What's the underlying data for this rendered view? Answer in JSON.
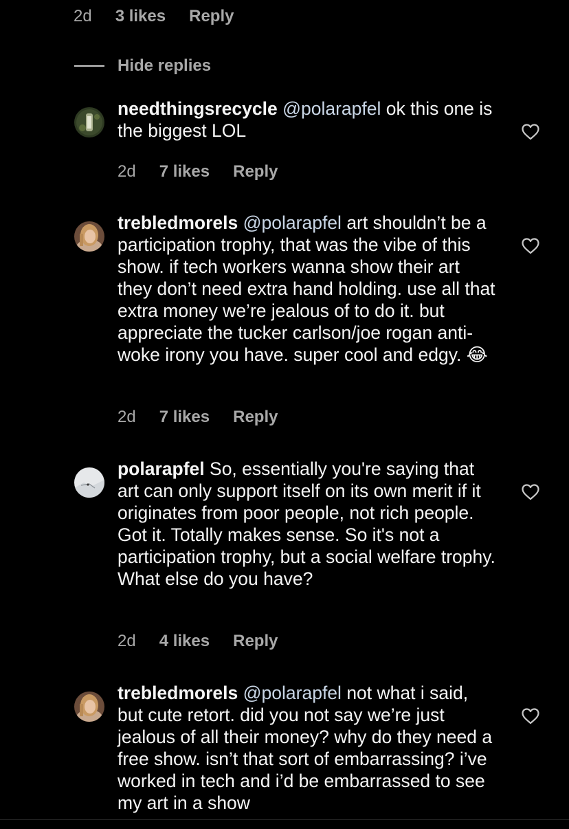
{
  "top_meta": {
    "time": "2d",
    "likes": "3 likes",
    "reply": "Reply"
  },
  "hide_replies": {
    "label": "Hide replies"
  },
  "comments": [
    {
      "username": "needthingsrecycle",
      "mention": "@polarapfel",
      "text": "ok this one is the biggest LOL",
      "time": "2d",
      "likes": "7 likes",
      "reply": "Reply",
      "avatar": "green-photo"
    },
    {
      "username": "trebledmorels",
      "mention": "@polarapfel",
      "text": "art shouldn’t be a participation trophy, that was the vibe of this show. if tech workers wanna show their art they don’t need extra hand holding. use all that extra money we’re jealous of to do it. but appreciate the tucker carlson/joe rogan anti-woke irony you have. super cool and edgy.",
      "emoji": "😂",
      "time": "2d",
      "likes": "7 likes",
      "reply": "Reply",
      "avatar": "portrait-photo"
    },
    {
      "username": "polarapfel",
      "mention": "",
      "text": "So, essentially you're saying that art can only support itself on its own merit if it originates from poor people, not rich people. Got it. Totally makes sense. So it's not a participation trophy, but a social welfare trophy. What else do you have?",
      "time": "2d",
      "likes": "4 likes",
      "reply": "Reply",
      "avatar": "snow-photo"
    },
    {
      "username": "trebledmorels",
      "mention": "@polarapfel",
      "text": "not what i said, but cute retort.  did you not say we’re just jealous of all their money? why do they need a free show. isn’t that sort of embarrassing? i’ve worked in tech and i’d be embarrassed to see my art in a show",
      "avatar": "portrait-photo"
    }
  ],
  "colors": {
    "background": "#000000",
    "primary_text": "#f5f5f5",
    "secondary_text": "#a8a8a8",
    "mention": "#c9d6e6"
  },
  "icons": [
    "heart-outline-icon",
    "hide-replies-line"
  ]
}
